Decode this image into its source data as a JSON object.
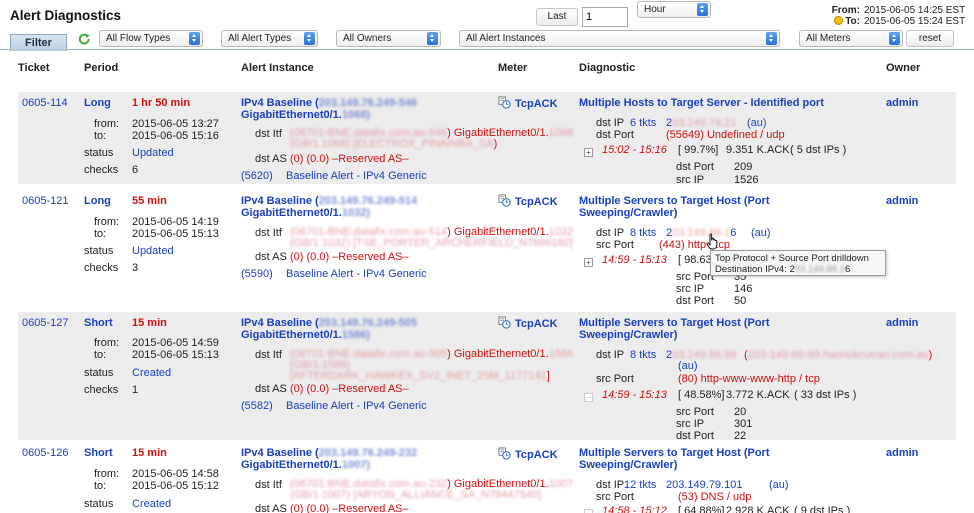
{
  "app": {
    "title": "Alert Diagnostics"
  },
  "timerange": {
    "last_label": "Last",
    "last_value": "1",
    "unit_selected": "Hour",
    "from_label": "From:",
    "to_label": "To:",
    "from_value": "2015-06-05 14:25 EST",
    "to_value": "2015-06-05 15:24 EST"
  },
  "filter": {
    "tab_label": "Filter",
    "flow_types": "All Flow Types",
    "alert_types": "All Alert Types",
    "owners": "All Owners",
    "instances": "All Alert Instances",
    "meters": "All Meters",
    "reset_label": "reset"
  },
  "columns": {
    "ticket": "Ticket",
    "period": "Period",
    "instance": "Alert Instance",
    "meter": "Meter",
    "diagnostic": "Diagnostic",
    "owner": "Owner"
  },
  "labels": {
    "from": "from:",
    "to": "to:",
    "status": "status",
    "checks": "checks",
    "dst_itf": "dst Itf",
    "dst_as": "dst AS",
    "dst_ip": "dst IP",
    "dst_port": "dst Port",
    "src_port": "src Port",
    "src_ip": "src IP"
  },
  "tooltip": {
    "line1": "Top Protocol + Source Port drilldown",
    "line2": "Destination IPv4: 2",
    "line2_tail": "6"
  },
  "rows": [
    {
      "ticket": "0605-114",
      "period": "Long",
      "duration": "1 hr 50 min",
      "from": "2015-06-05 13:27",
      "to": "2015-06-05 15:16",
      "status": "Updated",
      "checks": "6",
      "inst_title_a": "IPv4 Baseline (",
      "inst_title_b": "GigabitEthernet0/1.",
      "itf_right": ") GigabitEthernet0/1.",
      "itf_tail": ")",
      "dst_as_value": "(0) (0.0) –Reserved AS–",
      "baseline_id": "(5620)",
      "baseline_name": "Baseline Alert - IPv4 Generic",
      "meter": "TcpACK",
      "diag_title_1": "Multiple Hosts to Target Server - Identified port",
      "diag_title_2": "",
      "d1_label": "dst IP",
      "d1_tkts": "6 tkts",
      "d1_ip_head": "2",
      "d1_ip_tail": "",
      "d1_au": "(au)",
      "d2_label": "dst Port",
      "d2_value": "(55649) Undefined / udp",
      "window": "15:02 - 15:16",
      "pct": "[ 99.7%]",
      "rate": "9.351 K.ACK",
      "count": "( 5 dst IPs )",
      "sub": [
        {
          "label": "dst Port",
          "value": "209"
        },
        {
          "label": "src IP",
          "value": "1526"
        }
      ],
      "owner": "admin"
    },
    {
      "ticket": "0605-121",
      "period": "Long",
      "duration": "55 min",
      "from": "2015-06-05 14:19",
      "to": "2015-06-05 15:13",
      "status": "Updated",
      "checks": "3",
      "inst_title_a": "IPv4 Baseline (",
      "inst_title_b": "GigabitEthernet0/1.",
      "itf_right": ") GigabitEthernet0/1.",
      "itf_tail": "",
      "dst_as_value": "(0) (0.0) –Reserved AS–",
      "baseline_id": "(5590)",
      "baseline_name": "Baseline Alert - IPv4 Generic",
      "meter": "TcpACK",
      "diag_title_1": "Multiple Servers to Target Host (Port",
      "diag_title_2": "Sweeping/Crawler)",
      "d1_label": "dst IP",
      "d1_tkts": "8 tkts",
      "d1_ip_head": "2",
      "d1_ip_tail": "6",
      "d1_au": "(au)",
      "d2_label": "src Port",
      "d2_value": "(443) http",
      "d2_tail": "tcp",
      "window": "14:59 - 15:13",
      "pct": "[ 98.63",
      "rate": "",
      "count": "",
      "sub": [
        {
          "label": "src Port",
          "value": "35"
        },
        {
          "label": "src IP",
          "value": "146"
        },
        {
          "label": "dst Port",
          "value": "50"
        }
      ],
      "owner": "admin"
    },
    {
      "ticket": "0605-127",
      "period": "Short",
      "duration": "15 min",
      "from": "2015-06-05 14:59",
      "to": "2015-06-05 15:13",
      "status": "Created",
      "checks": "1",
      "inst_title_a": "IPv4 Baseline (",
      "inst_title_b": "GigabitEthernet0/1.",
      "itf_right": ") GigabitEthernet0/1.",
      "itf_tail": "]",
      "dst_as_value": "(0) (0.0) –Reserved AS–",
      "baseline_id": "(5582)",
      "baseline_name": "Baseline Alert - IPv4 Generic",
      "meter": "TcpACK",
      "diag_title_1": "Multiple Servers to Target Host (Port",
      "diag_title_2": "Sweeping/Crawler)",
      "d1_label": "dst IP",
      "d1_tkts": "8 tkts",
      "d1_ip_head": "2",
      "d1_ip_tail": "",
      "d1_au": "(au)",
      "d2_label": "src Port",
      "d2_value": "(80) http-www-www-http / tcp",
      "window": "14:59 - 15:13",
      "pct": "[ 48.58%]",
      "rate": "3.772 K.ACK",
      "count": "( 33 dst IPs )",
      "sub": [
        {
          "label": "src Port",
          "value": "20"
        },
        {
          "label": "src IP",
          "value": "301"
        },
        {
          "label": "dst Port",
          "value": "22"
        }
      ],
      "owner": "admin"
    },
    {
      "ticket": "0605-126",
      "period": "Short",
      "duration": "15 min",
      "from": "2015-06-05 14:58",
      "to": "2015-06-05 15:12",
      "status": "Created",
      "checks": "",
      "inst_title_a": "IPv4 Baseline (",
      "inst_title_b": "GigabitEthernet0/1.",
      "itf_right": ") GigabitEthernet0/1.",
      "itf_tail": "",
      "dst_as_value": "(0) (0.0) –Reserved AS–",
      "baseline_id": "",
      "baseline_name": "",
      "meter": "TcpACK",
      "diag_title_1": "Multiple Servers to Target Host (Port",
      "diag_title_2": "Sweeping/Crawler)",
      "d1_label": "dst IP",
      "d1_tkts": "12 tkts",
      "d1_ip_head": "203.149.79.101",
      "d1_ip_tail": "",
      "d1_au": "(au)",
      "d2_label": "src Port",
      "d2_value": "(53) DNS / udp",
      "window": "14:58 - 15:12",
      "pct": "[ 64.88%]",
      "rate": "2.928 K.ACK",
      "count": "( 9 dst IPs )",
      "sub": [],
      "owner": "admin"
    }
  ]
}
